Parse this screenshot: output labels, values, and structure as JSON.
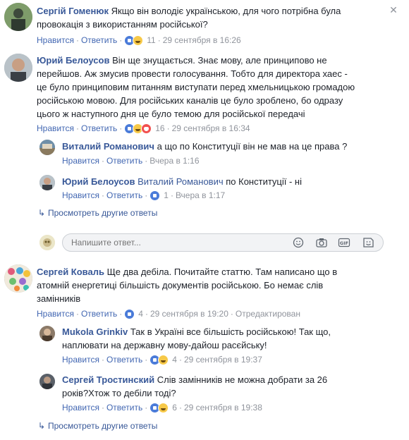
{
  "comments": [
    {
      "author": "Сергій Гоменюк",
      "text_lines": [
        "Якщо він володіє українською, для чого потрібна була",
        "провокація з використанням російської?"
      ],
      "like": "Нравится",
      "reply": "Ответить",
      "count": "11",
      "time": "29 сентября в 16:26"
    },
    {
      "author": "Юрий Белоусов",
      "text_lines": [
        "Він ще знущається. Знає мову, але принципово не",
        "перейшов. Аж змусив провести голосування. Тобто для директора хаес -",
        "це було принциповим питанням виступати перед хмельницькою громадою",
        "російською мовою. Для російських каналів це було зроблено, бо одразу",
        "цього ж наступного дня це було темою для російської передачі"
      ],
      "like": "Нравится",
      "reply": "Ответить",
      "count": "16",
      "time": "29 сентября в 16:34",
      "replies": [
        {
          "author": "Виталий Романович",
          "text": "а що по Конституції він не мав на це права ?",
          "like": "Нравится",
          "reply": "Ответить",
          "time": "Вчера в 1:16"
        },
        {
          "author": "Юрий Белоусов",
          "mention": "Виталий Романович",
          "text": "по Конституції - ні",
          "like": "Нравится",
          "reply": "Ответить",
          "count": "1",
          "time": "Вчера в 1:17"
        }
      ],
      "more_replies": "Просмотреть другие ответы",
      "input_placeholder": "Напишите ответ..."
    },
    {
      "author": "Сергей Коваль",
      "text_lines": [
        "Ще два дебіла. Почитайте статтю. Там написано що в",
        "атомній енергетиці більшість документів російською. Бо немає слів",
        "замінників"
      ],
      "like": "Нравится",
      "reply": "Ответить",
      "count": "4",
      "time": "29 сентября в 19:20",
      "edited": "Отредактирован",
      "replies": [
        {
          "author": "Mukola Grinkiv",
          "text_lines": [
            "Так в Україні все більшість російською! Так що,",
            "наплювати на державну мову-дайош расєйську!"
          ],
          "like": "Нравится",
          "reply": "Ответить",
          "count": "4",
          "time": "29 сентября в 19:37"
        },
        {
          "author": "Сергей Тростинский",
          "text_lines": [
            "Слів замінників не можна добрати за 26",
            "років?Хтож то дебіли тоді?"
          ],
          "like": "Нравится",
          "reply": "Ответить",
          "count": "6",
          "time": "29 сентября в 19:38"
        }
      ],
      "more_replies": "Просмотреть другие ответы"
    }
  ],
  "separator": "·",
  "colors": {
    "link": "#385898",
    "meta": "#90949c",
    "action": "#4267b2"
  },
  "icons": [
    "close-icon",
    "emoji-icon",
    "camera-icon",
    "gif-icon",
    "sticker-icon",
    "reply-arrow-icon"
  ]
}
